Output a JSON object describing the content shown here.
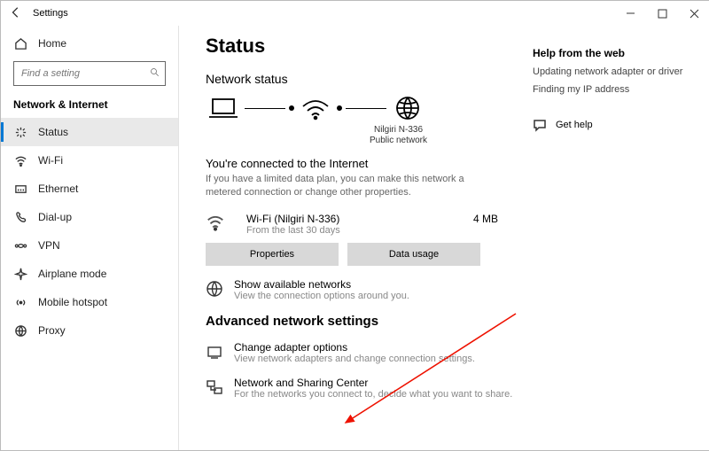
{
  "window": {
    "title": "Settings"
  },
  "sidebar": {
    "home_label": "Home",
    "search_placeholder": "Find a setting",
    "heading": "Network & Internet",
    "items": [
      {
        "label": "Status"
      },
      {
        "label": "Wi-Fi"
      },
      {
        "label": "Ethernet"
      },
      {
        "label": "Dial-up"
      },
      {
        "label": "VPN"
      },
      {
        "label": "Airplane mode"
      },
      {
        "label": "Mobile hotspot"
      },
      {
        "label": "Proxy"
      }
    ]
  },
  "main": {
    "page_title": "Status",
    "section_network_status": "Network status",
    "diagram": {
      "ssid": "Nilgiri N-336",
      "network_type": "Public network"
    },
    "connected_heading": "You're connected to the Internet",
    "connected_sub": "If you have a limited data plan, you can make this network a metered connection or change other properties.",
    "wifi_row": {
      "name": "Wi-Fi (Nilgiri N-336)",
      "sub": "From the last 30 days",
      "size": "4 MB"
    },
    "btn_properties": "Properties",
    "btn_data_usage": "Data usage",
    "link_show_networks": {
      "title": "Show available networks",
      "desc": "View the connection options around you."
    },
    "section_advanced": "Advanced network settings",
    "link_adapter": {
      "title": "Change adapter options",
      "desc": "View network adapters and change connection settings."
    },
    "link_sharing": {
      "title": "Network and Sharing Center",
      "desc": "For the networks you connect to, decide what you want to share."
    }
  },
  "right": {
    "heading": "Help from the web",
    "link1": "Updating network adapter or driver",
    "link2": "Finding my IP address",
    "get_help": "Get help"
  }
}
